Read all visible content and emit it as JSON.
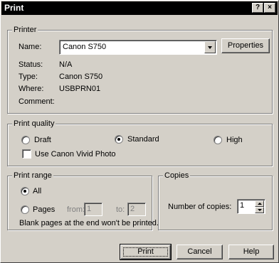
{
  "window": {
    "title": "Print",
    "help_glyph": "?",
    "close_glyph": "×"
  },
  "printer": {
    "group_label": "Printer",
    "name_label": "Name:",
    "name_value": "Canon S750",
    "properties_label": "Properties",
    "status_label": "Status:",
    "status_value": "N/A",
    "type_label": "Type:",
    "type_value": "Canon S750",
    "where_label": "Where:",
    "where_value": "USBPRN01",
    "comment_label": "Comment:",
    "comment_value": ""
  },
  "quality": {
    "group_label": "Print quality",
    "options": [
      "Draft",
      "Standard",
      "High"
    ],
    "selected": "Standard",
    "vivid_label": "Use Canon Vivid Photo",
    "vivid_checked": false
  },
  "range": {
    "group_label": "Print range",
    "all_label": "All",
    "pages_label": "Pages",
    "from_label": "from:",
    "from_value": "1",
    "to_label": "to:",
    "to_value": "2",
    "selected": "All",
    "note": "Blank pages at the end won't be printed."
  },
  "copies": {
    "group_label": "Copies",
    "number_label": "Number of copies:",
    "number_value": "1"
  },
  "buttons": {
    "print": "Print",
    "cancel": "Cancel",
    "help": "Help"
  }
}
